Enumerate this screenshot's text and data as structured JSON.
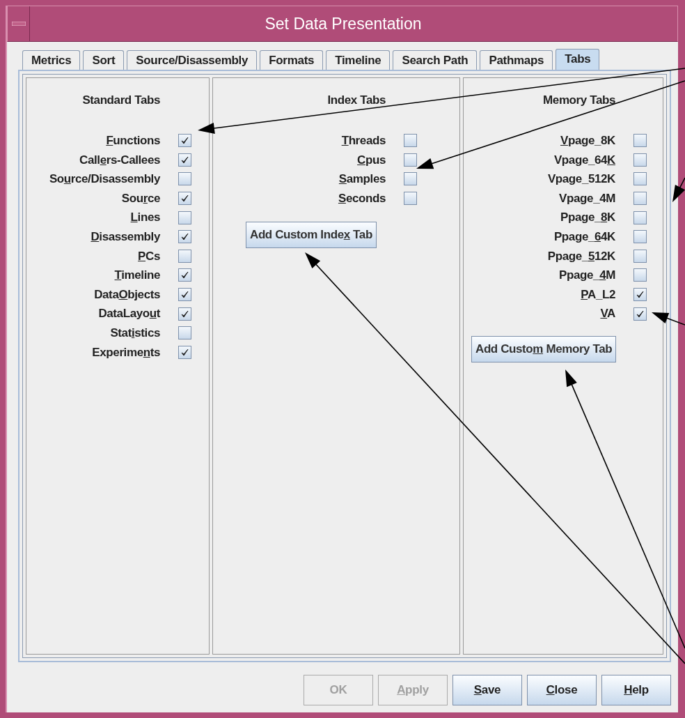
{
  "window": {
    "title": "Set Data Presentation"
  },
  "tabs": [
    {
      "label": "Metrics",
      "selected": false
    },
    {
      "label": "Sort",
      "selected": false
    },
    {
      "label": "Source/Disassembly",
      "selected": false
    },
    {
      "label": "Formats",
      "selected": false
    },
    {
      "label": "Timeline",
      "selected": false
    },
    {
      "label": "Search Path",
      "selected": false
    },
    {
      "label": "Pathmaps",
      "selected": false
    },
    {
      "label": "Tabs",
      "selected": true
    }
  ],
  "columns": [
    {
      "heading": "Standard Tabs",
      "items": [
        {
          "label": [
            {
              "text": "F",
              "underlined": true
            },
            {
              "text": "unctions",
              "underlined": false
            }
          ],
          "checked": true
        },
        {
          "label": [
            {
              "text": "Call",
              "underlined": false
            },
            {
              "text": "e",
              "underlined": true
            },
            {
              "text": "rs-Callees",
              "underlined": false
            }
          ],
          "checked": true
        },
        {
          "label": [
            {
              "text": "So",
              "underlined": false
            },
            {
              "text": "u",
              "underlined": true
            },
            {
              "text": "rce/Disassembly",
              "underlined": false
            }
          ],
          "checked": false
        },
        {
          "label": [
            {
              "text": "Sou",
              "underlined": false
            },
            {
              "text": "r",
              "underlined": true
            },
            {
              "text": "ce",
              "underlined": false
            }
          ],
          "checked": true
        },
        {
          "label": [
            {
              "text": "L",
              "underlined": true
            },
            {
              "text": "ines",
              "underlined": false
            }
          ],
          "checked": false
        },
        {
          "label": [
            {
              "text": "D",
              "underlined": true
            },
            {
              "text": "isassembly",
              "underlined": false
            }
          ],
          "checked": true
        },
        {
          "label": [
            {
              "text": "P",
              "underlined": true
            },
            {
              "text": "Cs",
              "underlined": false
            }
          ],
          "checked": false
        },
        {
          "label": [
            {
              "text": "T",
              "underlined": true
            },
            {
              "text": "imeline",
              "underlined": false
            }
          ],
          "checked": true
        },
        {
          "label": [
            {
              "text": "Data",
              "underlined": false
            },
            {
              "text": "O",
              "underlined": true
            },
            {
              "text": "bjects",
              "underlined": false
            }
          ],
          "checked": true
        },
        {
          "label": [
            {
              "text": "DataLayo",
              "underlined": false
            },
            {
              "text": "u",
              "underlined": true
            },
            {
              "text": "t",
              "underlined": false
            }
          ],
          "checked": true
        },
        {
          "label": [
            {
              "text": "Stat",
              "underlined": false
            },
            {
              "text": "i",
              "underlined": true
            },
            {
              "text": "stics",
              "underlined": false
            }
          ],
          "checked": false
        },
        {
          "label": [
            {
              "text": "Experime",
              "underlined": false
            },
            {
              "text": "n",
              "underlined": true
            },
            {
              "text": "ts",
              "underlined": false
            }
          ],
          "checked": true
        }
      ]
    },
    {
      "heading": "Index Tabs",
      "items": [
        {
          "label": [
            {
              "text": "T",
              "underlined": true
            },
            {
              "text": "hreads",
              "underlined": false
            }
          ],
          "checked": false
        },
        {
          "label": [
            {
              "text": "C",
              "underlined": true
            },
            {
              "text": "pus",
              "underlined": false
            }
          ],
          "checked": false
        },
        {
          "label": [
            {
              "text": "S",
              "underlined": true
            },
            {
              "text": "amples",
              "underlined": false
            }
          ],
          "checked": false
        },
        {
          "label": [
            {
              "text": "S",
              "underlined": true
            },
            {
              "text": "econds",
              "underlined": false
            }
          ],
          "checked": false
        }
      ],
      "button": {
        "label": [
          {
            "text": "Add Custom Inde",
            "underlined": false
          },
          {
            "text": "x",
            "underlined": true
          },
          {
            "text": " Tab",
            "underlined": false
          }
        ]
      }
    },
    {
      "heading": "Memory Tabs",
      "items": [
        {
          "label": [
            {
              "text": "V",
              "underlined": true
            },
            {
              "text": "page_8K",
              "underlined": false
            }
          ],
          "checked": false
        },
        {
          "label": [
            {
              "text": "Vpage_64",
              "underlined": false
            },
            {
              "text": "K",
              "underlined": true
            }
          ],
          "checked": false
        },
        {
          "label": [
            {
              "text": "Vpage_512K",
              "underlined": false
            }
          ],
          "checked": false
        },
        {
          "label": [
            {
              "text": "Vpage_4M",
              "underlined": false
            }
          ],
          "checked": false
        },
        {
          "label": [
            {
              "text": "Ppage_",
              "underlined": false
            },
            {
              "text": "8",
              "underlined": true
            },
            {
              "text": "K",
              "underlined": false
            }
          ],
          "checked": false
        },
        {
          "label": [
            {
              "text": "Ppage_",
              "underlined": false
            },
            {
              "text": "6",
              "underlined": true
            },
            {
              "text": "4K",
              "underlined": false
            }
          ],
          "checked": false
        },
        {
          "label": [
            {
              "text": "Ppage_",
              "underlined": false
            },
            {
              "text": "5",
              "underlined": true
            },
            {
              "text": "12K",
              "underlined": false
            }
          ],
          "checked": false
        },
        {
          "label": [
            {
              "text": "Ppage_",
              "underlined": false
            },
            {
              "text": "4",
              "underlined": true
            },
            {
              "text": "M",
              "underlined": false
            }
          ],
          "checked": false
        },
        {
          "label": [
            {
              "text": "P",
              "underlined": true
            },
            {
              "text": "A_L2",
              "underlined": false
            }
          ],
          "checked": true
        },
        {
          "label": [
            {
              "text": "V",
              "underlined": true
            },
            {
              "text": "A",
              "underlined": false
            }
          ],
          "checked": true
        }
      ],
      "button": {
        "label": [
          {
            "text": "Add Custo",
            "underlined": false
          },
          {
            "text": "m",
            "underlined": true
          },
          {
            "text": " Memory Tab",
            "underlined": false
          }
        ]
      }
    }
  ],
  "buttons": [
    {
      "label": [
        {
          "text": "OK",
          "underlined": false
        }
      ],
      "disabled": true
    },
    {
      "label": [
        {
          "text": "A",
          "underlined": true
        },
        {
          "text": "pply",
          "underlined": false
        }
      ],
      "disabled": true
    },
    {
      "label": [
        {
          "text": "S",
          "underlined": true
        },
        {
          "text": "ave",
          "underlined": false
        }
      ],
      "disabled": false
    },
    {
      "label": [
        {
          "text": "C",
          "underlined": true
        },
        {
          "text": "lose",
          "underlined": false
        }
      ],
      "disabled": false
    },
    {
      "label": [
        {
          "text": "H",
          "underlined": true
        },
        {
          "text": "elp",
          "underlined": false
        }
      ],
      "disabled": false
    }
  ]
}
